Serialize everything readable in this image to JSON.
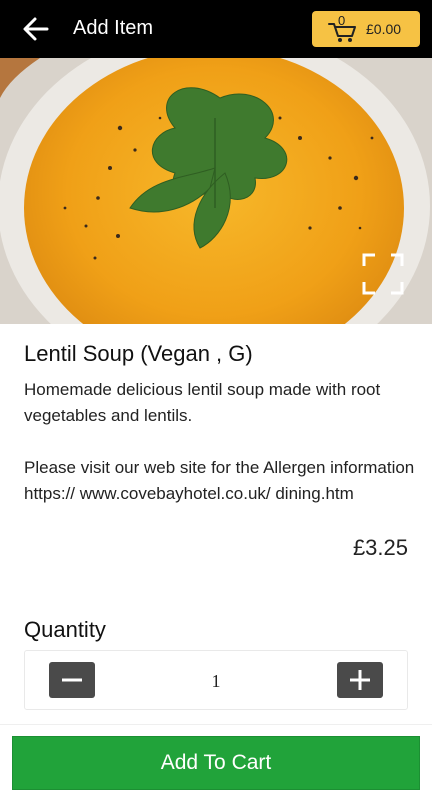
{
  "header": {
    "title": "Add Item",
    "cart_count": "0",
    "cart_total": "£0.00",
    "back_icon": "arrow-left-icon",
    "cart_icon": "shopping-cart-icon"
  },
  "hero": {
    "image_description": "bowl of lentil soup with parsley",
    "zoom_icon": "expand-icon"
  },
  "item": {
    "name": "Lentil Soup (Vegan , G)",
    "description_1": "Homemade delicious lentil soup made with root vegetables and lentils.",
    "description_2": "Please visit our web site for the Allergen information https:// www.covebayhotel.co.uk/ dining.htm",
    "price": "£3.25"
  },
  "quantity": {
    "label": "Quantity",
    "value": "1",
    "minus_icon": "minus-icon",
    "plus_icon": "plus-icon"
  },
  "actions": {
    "add_to_cart": "Add To Cart"
  },
  "colors": {
    "topbar": "#000000",
    "cart_button": "#f6c244",
    "add_button": "#21a33a",
    "qty_button": "#4a4a4a",
    "soup": "#f2a51c"
  }
}
